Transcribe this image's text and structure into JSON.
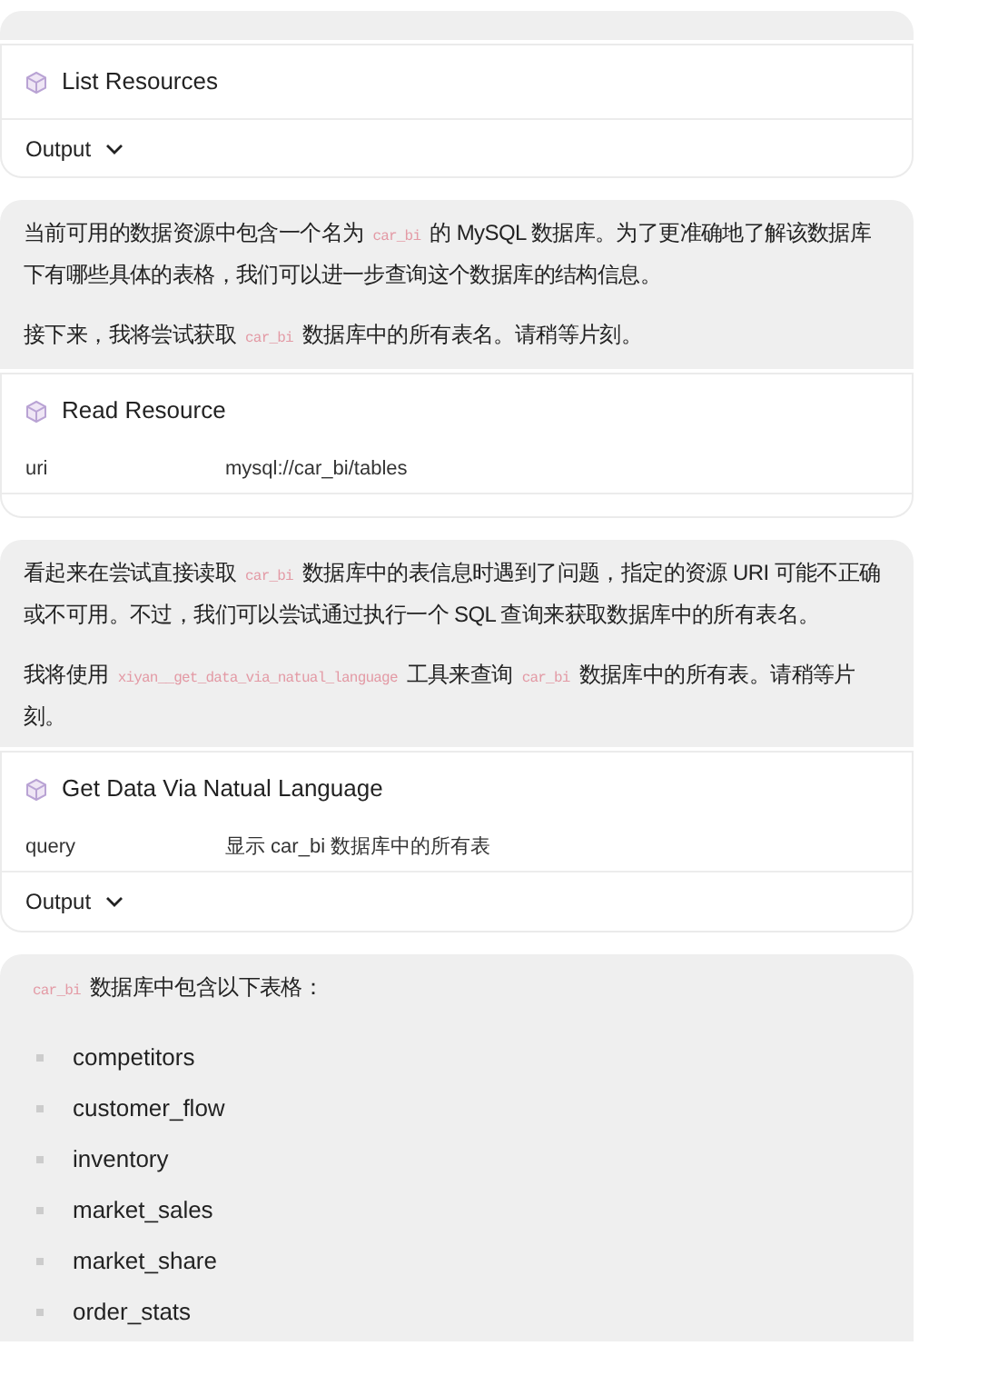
{
  "blocks": [
    {
      "kind": "message"
    },
    {
      "kind": "tool",
      "title": "List Resources",
      "output": {
        "label": "Output",
        "expanded": false
      }
    },
    {
      "kind": "message",
      "paragraphs": [
        [
          {
            "kind": "text",
            "text": "当前可用的数据资源中包含一个名为"
          },
          {
            "kind": "code",
            "text": "car_bi"
          },
          {
            "kind": "text",
            "text": "的 MySQL 数据库。为了更准确地了解该数据库下有哪些具体的表格，我们可以进一步查询这个数据库的结构信息。"
          }
        ],
        [
          {
            "kind": "text",
            "text": "接下来，我将尝试获取"
          },
          {
            "kind": "code",
            "text": "car_bi"
          },
          {
            "kind": "text",
            "text": "数据库中的所有表名。请稍等片刻。"
          }
        ]
      ]
    },
    {
      "kind": "tool",
      "title": "Read Resource",
      "params": [
        {
          "key": "uri",
          "value": "mysql://car_bi/tables"
        }
      ]
    },
    {
      "kind": "message",
      "paragraphs": [
        [
          {
            "kind": "text",
            "text": "看起来在尝试直接读取"
          },
          {
            "kind": "code",
            "text": "car_bi"
          },
          {
            "kind": "text",
            "text": "数据库中的表信息时遇到了问题，指定的资源 URI 可能不正确或不可用。不过，我们可以尝试通过执行一个 SQL 查询来获取数据库中的所有表名。"
          }
        ],
        [
          {
            "kind": "text",
            "text": "我将使用"
          },
          {
            "kind": "code",
            "text": "xiyan__get_data_via_natual_language"
          },
          {
            "kind": "text",
            "text": "工具来查询"
          },
          {
            "kind": "code",
            "text": "car_bi"
          },
          {
            "kind": "text",
            "text": "数据库中的所有表。请稍等片刻。"
          }
        ]
      ]
    },
    {
      "kind": "tool",
      "title": "Get Data Via Natual Language",
      "params": [
        {
          "key": "query",
          "value": "显示 car_bi 数据库中的所有表"
        }
      ],
      "output": {
        "label": "Output",
        "expanded": false
      }
    },
    {
      "kind": "message",
      "paragraphs": [
        [
          {
            "kind": "code",
            "text": "car_bi"
          },
          {
            "kind": "text",
            "text": "数据库中包含以下表格："
          }
        ]
      ],
      "list": [
        "competitors",
        "customer_flow",
        "inventory",
        "market_sales",
        "market_share",
        "order_stats"
      ]
    }
  ]
}
